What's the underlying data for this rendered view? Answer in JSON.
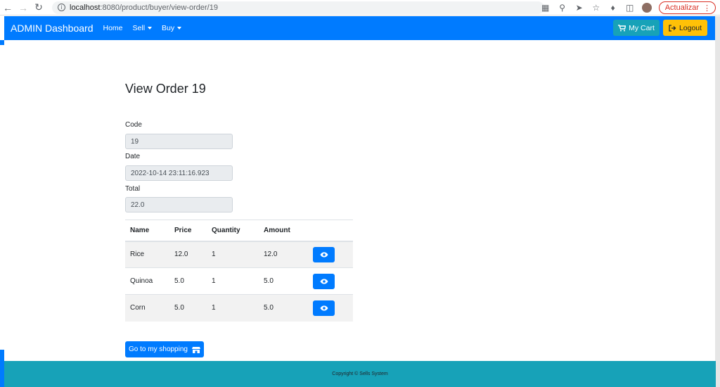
{
  "browser": {
    "url_host": "localhost",
    "url_path": ":8080/product/buyer/view-order/19",
    "update_label": "Actualizar"
  },
  "navbar": {
    "brand": "ADMIN Dashboard",
    "links": [
      {
        "label": "Home"
      },
      {
        "label": "Sell"
      },
      {
        "label": "Buy"
      }
    ],
    "cart_label": "My Cart",
    "logout_label": "Logout"
  },
  "page": {
    "title": "View Order 19",
    "fields": {
      "code_label": "Code",
      "code_value": "19",
      "date_label": "Date",
      "date_value": "2022-10-14 23:11:16.923",
      "total_label": "Total",
      "total_value": "22.0"
    },
    "table": {
      "headers": [
        "Name",
        "Price",
        "Quantity",
        "Amount"
      ],
      "rows": [
        {
          "name": "Rice",
          "price": "12.0",
          "quantity": "1",
          "amount": "12.0"
        },
        {
          "name": "Quinoa",
          "price": "5.0",
          "quantity": "1",
          "amount": "5.0"
        },
        {
          "name": "Corn",
          "price": "5.0",
          "quantity": "1",
          "amount": "5.0"
        }
      ]
    },
    "shop_button_label": "Go to my shopping"
  },
  "footer": {
    "text": "Copyright © Sells System"
  },
  "colors": {
    "primary": "#007bff",
    "info": "#17a2b8",
    "warning": "#ffc107"
  }
}
